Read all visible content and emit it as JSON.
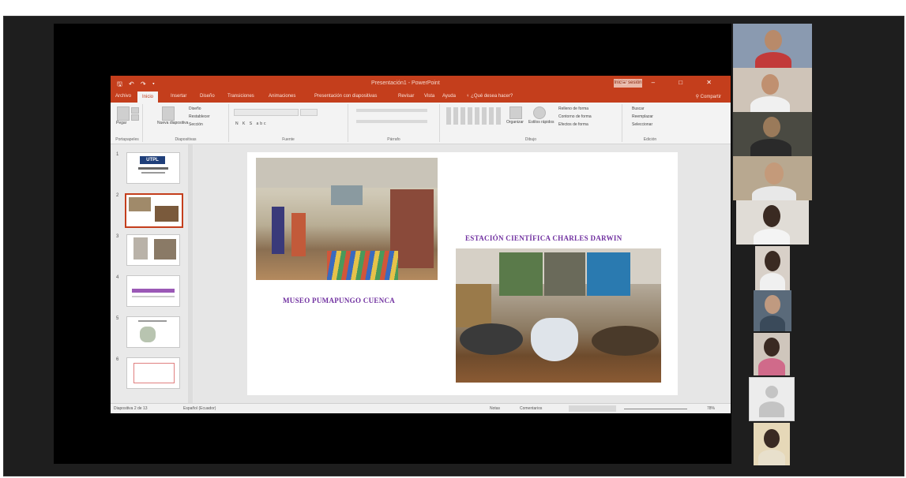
{
  "window": {
    "quick_access": "🖫 ↶ ↷ ▾",
    "document_title": "Presentación1 - PowerPoint",
    "sign_in": "Iniciar sesión",
    "window_buttons": "▭ – □ ✕"
  },
  "ribbon_tabs": [
    "Archivo",
    "Inicio",
    "Insertar",
    "Diseño",
    "Transiciones",
    "Animaciones",
    "Presentación con diapositivas",
    "Revisar",
    "Vista",
    "Ayuda",
    "♀ ¿Qué desea hacer?"
  ],
  "share_label": "Compartir",
  "ribbon_groups": [
    {
      "label": "Portapapeles",
      "items": [
        "Pegar"
      ]
    },
    {
      "label": "Diapositivas",
      "items": [
        "Nueva diapositiva",
        "Diseño",
        "Restablecer",
        "Sección"
      ]
    },
    {
      "label": "Fuente",
      "items": [
        "N K S abc"
      ]
    },
    {
      "label": "Párrafo",
      "items": []
    },
    {
      "label": "Dibujo",
      "items": [
        "Organizar",
        "Estilos rápidos",
        "Relleno de forma",
        "Contorno de forma",
        "Efectos de forma"
      ]
    },
    {
      "label": "Edición",
      "items": [
        "Buscar",
        "Reemplazar",
        "Seleccionar"
      ]
    }
  ],
  "thumbnails": [
    {
      "num": "1",
      "logo": "UTPL"
    },
    {
      "num": "2"
    },
    {
      "num": "3"
    },
    {
      "num": "4"
    },
    {
      "num": "5"
    },
    {
      "num": "6"
    }
  ],
  "slide": {
    "caption_left": "MUSEO PUMAPUNGO CUENCA",
    "caption_right": "ESTACIÓN CIENTÍFICA CHARLES DARWIN"
  },
  "statusbar": {
    "slide_info": "Diapositiva 2 de 13",
    "language": "Español (Ecuador)",
    "notes": "Notas",
    "comments": "Comentarios",
    "zoom": "78%"
  },
  "colors": {
    "accent": "#c43e1c",
    "caption": "#7030a0"
  }
}
